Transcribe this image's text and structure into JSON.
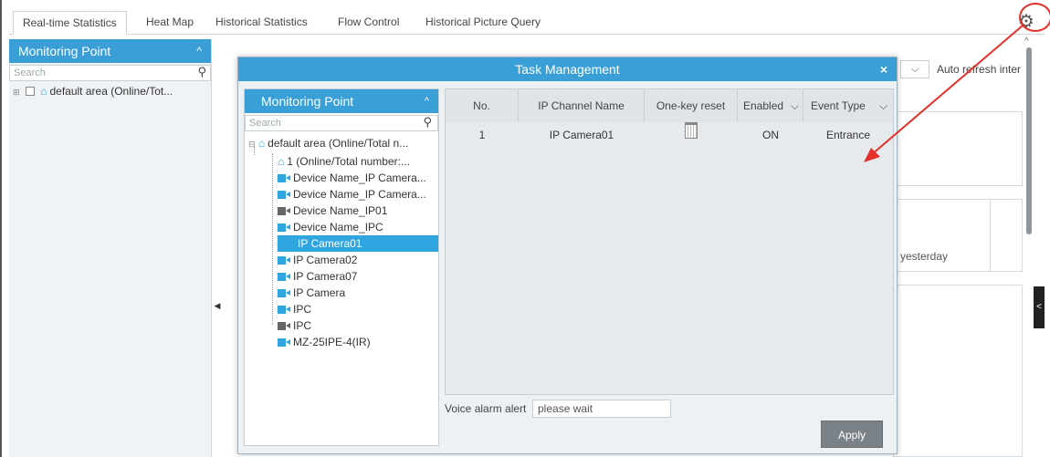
{
  "tabs": [
    {
      "label": "Real-time Statistics",
      "active": true
    },
    {
      "label": "Heat Map",
      "active": false
    },
    {
      "label": "Historical Statistics",
      "active": false
    },
    {
      "label": "Flow Control",
      "active": false
    },
    {
      "label": "Historical Picture Query",
      "active": false
    }
  ],
  "left_panel": {
    "title": "Monitoring Point",
    "search_placeholder": "Search",
    "tree_root": "default area (Online/Tot..."
  },
  "background": {
    "refresh_label": "Auto refresh inter",
    "yesterday_label": "yesterday"
  },
  "dialog": {
    "title": "Task Management",
    "close_label": "×",
    "tree": {
      "title": "Monitoring Point",
      "search_placeholder": "Search",
      "items": [
        {
          "label": "default area (Online/Total n...",
          "icon": "house-icon",
          "selected": false
        },
        {
          "label": "1 (Online/Total number:...",
          "icon": "house-icon",
          "selected": false
        },
        {
          "label": "Device Name_IP Camera...",
          "icon": "camera-icon",
          "selected": false
        },
        {
          "label": "Device Name_IP Camera...",
          "icon": "camera-icon",
          "selected": false
        },
        {
          "label": "Device Name_IP01",
          "icon": "camera-offline-icon",
          "selected": false
        },
        {
          "label": "Device Name_IPC",
          "icon": "camera-icon",
          "selected": false
        },
        {
          "label": "IP Camera01",
          "icon": "none",
          "selected": true
        },
        {
          "label": "IP Camera02",
          "icon": "camera-icon",
          "selected": false
        },
        {
          "label": "IP Camera07",
          "icon": "camera-icon",
          "selected": false
        },
        {
          "label": "IP Camera",
          "icon": "camera-icon",
          "selected": false
        },
        {
          "label": "IPC",
          "icon": "camera-icon",
          "selected": false
        },
        {
          "label": "IPC",
          "icon": "camera-offline-icon",
          "selected": false
        },
        {
          "label": "MZ-25IPE-4(IR)",
          "icon": "camera-icon",
          "selected": false
        }
      ]
    },
    "table": {
      "columns": [
        "No.",
        "IP Channel Name",
        "One-key reset",
        "Enabled",
        "Event Type"
      ],
      "rows": [
        {
          "no": "1",
          "channel": "IP Camera01",
          "reset_icon": "trash-icon",
          "enabled": "ON",
          "event_type": "Entrance"
        }
      ]
    },
    "voice_label": "Voice alarm alert",
    "voice_value": "please wait",
    "apply_label": "Apply"
  },
  "colors": {
    "accent": "#3a9fd6",
    "selected": "#2fa6e0",
    "annotation": "#e3302a"
  }
}
